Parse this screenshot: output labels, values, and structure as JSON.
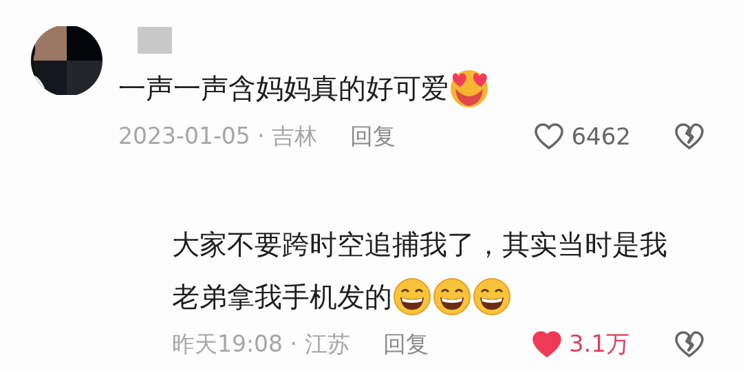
{
  "comments": [
    {
      "kind": "comment",
      "text": "一声一声含妈妈真的好可爱",
      "emojis": [
        {
          "kind": "heart-eyes"
        }
      ],
      "date": "2023-01-05 · 吉林",
      "reply_label": "回复",
      "liked": false,
      "likes": "6462"
    },
    {
      "kind": "reply",
      "text_lines": [
        "大家不要跨时空追捕我了，其实当时是我",
        "老弟拿我手机发的"
      ],
      "emojis": [
        {
          "kind": "grin"
        },
        {
          "kind": "grin"
        },
        {
          "kind": "grin"
        }
      ],
      "date": "昨天19:08 · 江苏",
      "reply_label": "回复",
      "liked": true,
      "likes": "3.1万"
    }
  ]
}
